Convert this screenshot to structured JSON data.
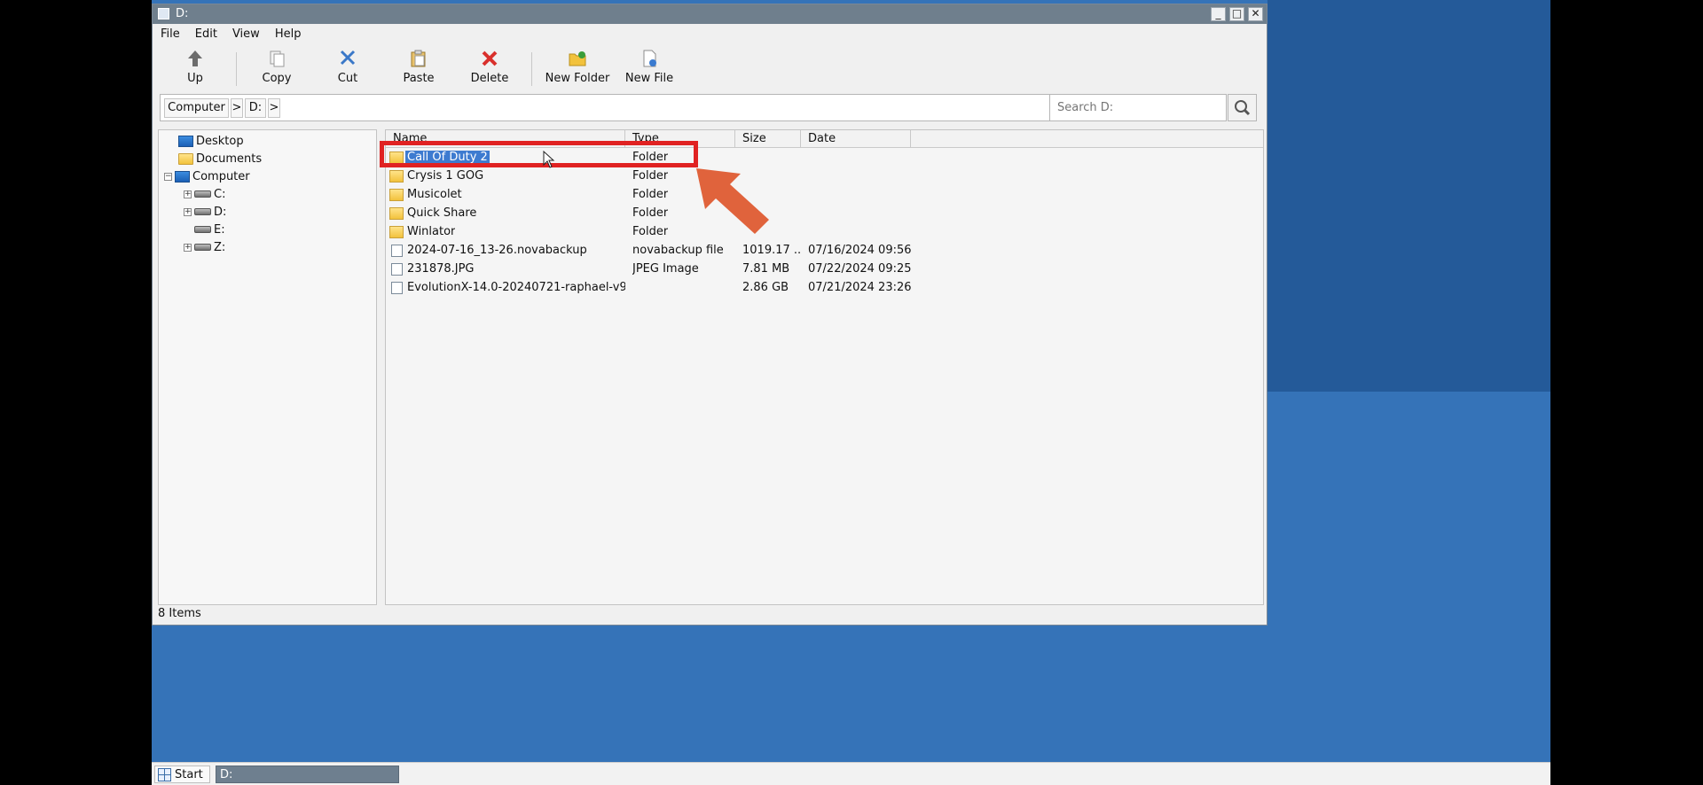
{
  "window": {
    "title": "D:",
    "controls": {
      "minimize": "_",
      "maximize": "□",
      "close": "✕"
    }
  },
  "menu": [
    "File",
    "Edit",
    "View",
    "Help"
  ],
  "toolbar": {
    "up": "Up",
    "copy": "Copy",
    "cut": "Cut",
    "paste": "Paste",
    "delete": "Delete",
    "new_folder": "New Folder",
    "new_file": "New File"
  },
  "address": {
    "crumbs": [
      "Computer",
      "D:"
    ],
    "separator": ">"
  },
  "search": {
    "placeholder": "Search D:"
  },
  "tree": {
    "items": [
      {
        "label": "Desktop",
        "icon": "desktop-icon"
      },
      {
        "label": "Documents",
        "icon": "folder-icon"
      },
      {
        "label": "Computer",
        "icon": "computer-icon",
        "expander": "−"
      },
      {
        "label": "C:",
        "icon": "drive-icon",
        "expander": "+"
      },
      {
        "label": "D:",
        "icon": "drive-icon",
        "expander": "+"
      },
      {
        "label": "E:",
        "icon": "drive-icon"
      },
      {
        "label": "Z:",
        "icon": "drive-icon",
        "expander": "+"
      }
    ]
  },
  "list": {
    "columns": [
      "Name",
      "Type",
      "Size",
      "Date"
    ],
    "rows": [
      {
        "name": "Call Of Duty 2",
        "type": "Folder",
        "size": "",
        "date": "",
        "icon": "folder-icon",
        "selected": true
      },
      {
        "name": "Crysis 1 GOG",
        "type": "Folder",
        "size": "",
        "date": "",
        "icon": "folder-icon"
      },
      {
        "name": "Musicolet",
        "type": "Folder",
        "size": "",
        "date": "",
        "icon": "folder-icon"
      },
      {
        "name": "Quick Share",
        "type": "Folder",
        "size": "",
        "date": "",
        "icon": "folder-icon"
      },
      {
        "name": "Winlator",
        "type": "Folder",
        "size": "",
        "date": "",
        "icon": "folder-icon"
      },
      {
        "name": "2024-07-16_13-26.novabackup",
        "type": "novabackup file",
        "size": "1019.17 ...",
        "date": "07/16/2024 09:56",
        "icon": "file-icon"
      },
      {
        "name": "231878.JPG",
        "type": "JPEG Image",
        "size": "7.81 MB",
        "date": "07/22/2024 09:25",
        "icon": "file-icon"
      },
      {
        "name": "EvolutionX-14.0-20240721-raphael-v9...",
        "type": "",
        "size": "2.86 GB",
        "date": "07/21/2024 23:26",
        "icon": "file-icon"
      }
    ]
  },
  "status": {
    "text": "8 Items"
  },
  "taskbar": {
    "start": "Start",
    "task": "D:"
  },
  "colors": {
    "highlight": "#e02222",
    "arrow": "#e0633c",
    "selection": "#3d7bd0",
    "desktop": "#3573b8",
    "titlebar": "#6f7f8d"
  }
}
